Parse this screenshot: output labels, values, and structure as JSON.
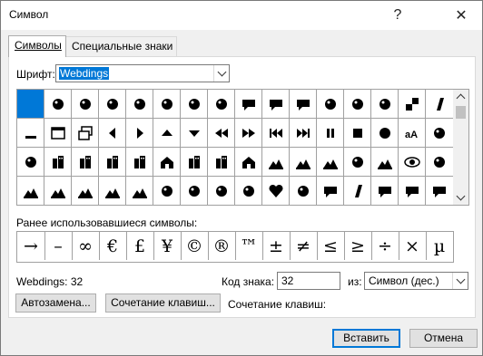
{
  "window": {
    "title": "Символ",
    "help_label": "?",
    "close_label": "✕"
  },
  "tabs": [
    {
      "label": "Символы"
    },
    {
      "label": "Специальные знаки"
    }
  ],
  "font": {
    "label": "Шрифт:",
    "value": "Webdings"
  },
  "symbol_grid": {
    "rows": [
      [
        "blank-selected",
        "spider-icon",
        "spiderweb-icon",
        "face-icon",
        "sunglasses-icon",
        "trophy-icon",
        "medal-icon",
        "music-note-icon",
        "speech-bubble-icon",
        "speech-bubble-right-icon",
        "speech-bubble-left-icon",
        "starburst-icon",
        "chili-pepper-icon",
        "ribbon-icon",
        "checkered-squares-icon",
        "slash-bar-icon"
      ],
      [
        "minimize-icon",
        "window-icon",
        "restore-icon",
        "arrow-left-icon",
        "arrow-right-icon",
        "arrow-up-icon",
        "arrow-down-icon",
        "rewind-icon",
        "fast-forward-icon",
        "skip-back-icon",
        "skip-forward-icon",
        "pause-icon",
        "stop-icon",
        "record-icon",
        "text-size-icon",
        "box-icon"
      ],
      [
        "tools-icon",
        "building-icon",
        "city-icon",
        "town-icon",
        "factory-icon",
        "houses-icon",
        "industry-icon",
        "museum-icon",
        "house-icon",
        "beach-icon",
        "island-icon",
        "road-icon",
        "pin-icon",
        "mountain-icon",
        "eye-icon",
        "ear-icon"
      ],
      [
        "forest-icon",
        "camp-icon",
        "highway-icon",
        "stadium-icon",
        "ship-icon",
        "speaker-icon",
        "megaphone-icon",
        "pen-nib-icon",
        "mute-icon",
        "heart-icon",
        "fairy-icon",
        "cloud-bubble-icon",
        "diagonal-bar-icon",
        "oval-bubble-icon",
        "chat-icon",
        "chats-icon"
      ]
    ]
  },
  "recent": {
    "label": "Ранее использовавшиеся символы:",
    "symbols": [
      "→",
      "–",
      "∞",
      "€",
      "£",
      "¥",
      "©",
      "®",
      "™",
      "±",
      "≠",
      "≤",
      "≥",
      "÷",
      "×",
      "µ"
    ]
  },
  "info": {
    "font_code": "Webdings: 32",
    "code_label": "Код знака:",
    "code_value": "32",
    "from_label": "из:",
    "from_value": "Символ (дес.)",
    "shortcut_label": "Сочетание клавиш:"
  },
  "buttons": {
    "autocorrect": "Автозамена...",
    "shortcut": "Сочетание клавиш...",
    "insert": "Вставить",
    "cancel": "Отмена"
  },
  "colors": {
    "selection": "#0078d7",
    "accent": "#0078d7"
  }
}
